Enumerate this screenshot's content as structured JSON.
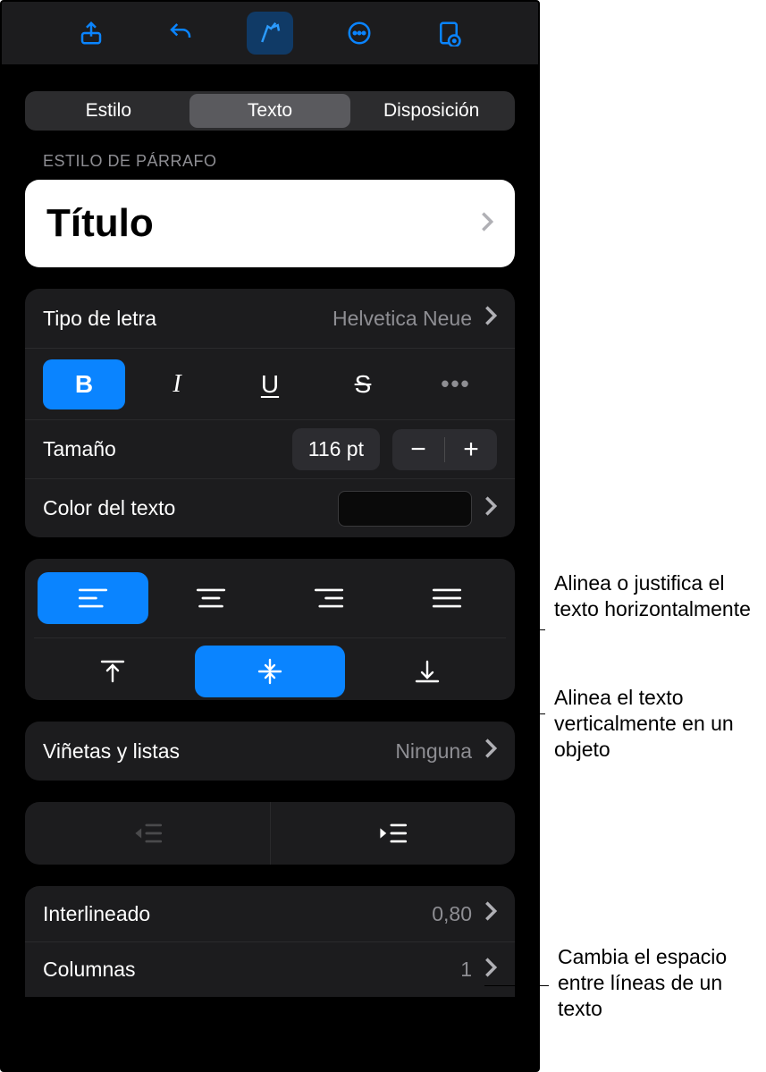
{
  "tabs": {
    "style": "Estilo",
    "text": "Texto",
    "layout": "Disposición"
  },
  "section": {
    "paragraph_style_label": "ESTILO DE PÁRRAFO"
  },
  "paragraph_style": {
    "name": "Título"
  },
  "font": {
    "type_label": "Tipo de letra",
    "type_value": "Helvetica Neue",
    "bold": "B",
    "italic": "I",
    "under": "U",
    "strike": "S",
    "more": "•••",
    "size_label": "Tamaño",
    "size_value": "116 pt",
    "color_label": "Color del texto"
  },
  "bullets": {
    "label": "Viñetas y listas",
    "value": "Ninguna"
  },
  "spacing": {
    "label": "Interlineado",
    "value": "0,80"
  },
  "columns": {
    "label": "Columnas",
    "value": "1"
  },
  "callouts": {
    "halign": "Alinea o justifica el texto horizontalmente",
    "valign": "Alinea el texto verticalmente en un objeto",
    "linespace": "Cambia el espacio entre líneas de un texto"
  }
}
